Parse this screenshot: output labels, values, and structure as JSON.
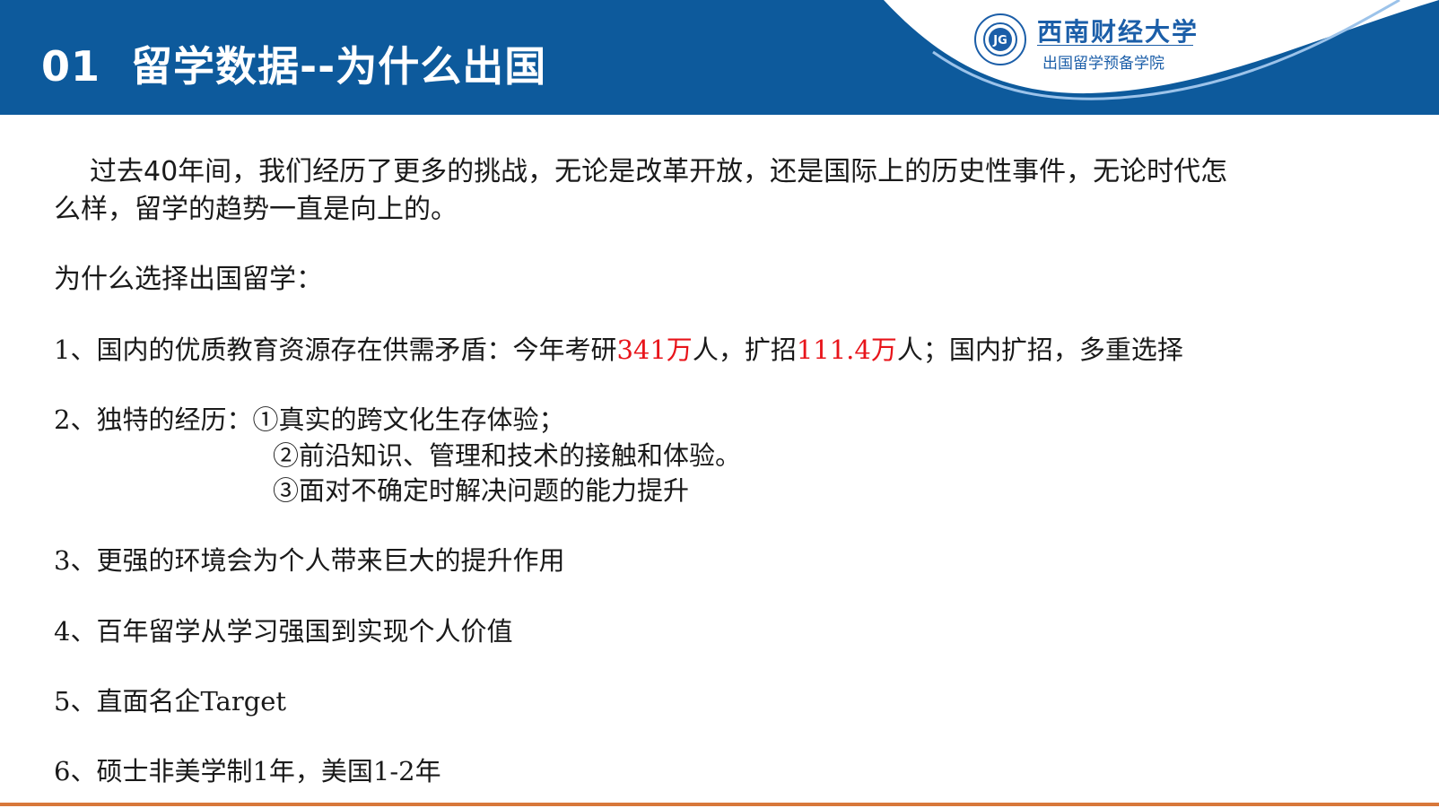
{
  "header": {
    "number": "01",
    "title": "留学数据--为什么出国",
    "logo_name": "西南财经大学",
    "logo_sub": "出国留学预备学院",
    "logo_emblem_letters": "JG"
  },
  "intro": {
    "line1": "过去40年间，我们经历了更多的挑战，无论是改革开放，还是国际上的历史性事件，无论时代怎",
    "line2": "么样，留学的趋势一直是向上的。"
  },
  "reasons_heading": "为什么选择出国留学：",
  "item1": {
    "prefix": "1、国内的优质教育资源存在供需矛盾：今年考研",
    "num1": "341万",
    "mid": "人，扩招",
    "num2": "111.4万",
    "suffix": "人；国内扩招，多重选择"
  },
  "item2": {
    "line1": "2、独特的经历：①真实的跨文化生存体验；",
    "line2": "②前沿知识、管理和技术的接触和体验。",
    "line3": "③面对不确定时解决问题的能力提升"
  },
  "item3": "3、更强的环境会为个人带来巨大的提升作用",
  "item4": "4、百年留学从学习强国到实现个人价值",
  "item5": "5、直面名企Target",
  "item6": "6、硕士非美学制1年，美国1-2年",
  "colors": {
    "header_blue": "#0d5a9c",
    "highlight_red": "#e8141a",
    "bottom_rule": "#d8783a"
  }
}
